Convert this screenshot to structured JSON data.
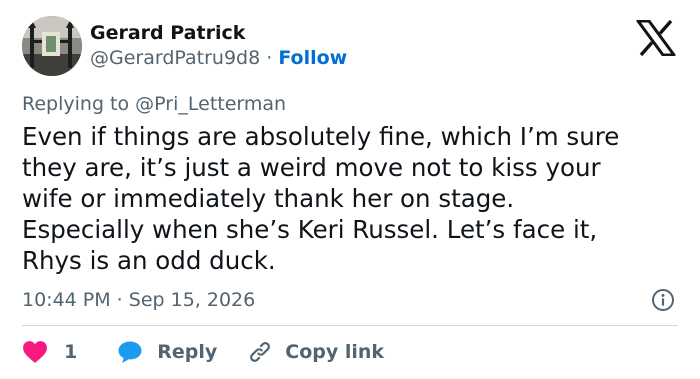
{
  "tweet": {
    "author": {
      "name": "Gerard Patrick",
      "handle": "@GerardPatru9d8",
      "separator": "·",
      "follow_label": "Follow"
    },
    "reply_prefix": "Replying to",
    "reply_to": "@Pri_Letterman",
    "text_lines": [
      "Even if things are absolutely fine, which I’m sure",
      "they are,  it’s just a weird move not to kiss your",
      "wife or immediately thank her on stage.",
      "Especially when she’s Keri Russel.  Let’s face it,",
      "Rhys is an odd duck."
    ],
    "timestamp": "10:44 PM · Sep 15, 2026"
  },
  "actions": {
    "like_count": "1",
    "reply_label": "Reply",
    "copy_label": "Copy link"
  },
  "icons": {
    "brand": "x-logo-icon",
    "info": "info-icon",
    "like": "heart-icon",
    "reply": "reply-bubble-icon",
    "copy": "link-icon"
  },
  "colors": {
    "text": "#0f1419",
    "secondary": "#536471",
    "follow": "#006fd6",
    "like": "#f91880",
    "reply": "#1d9bf0",
    "divider": "#cfd9de"
  }
}
